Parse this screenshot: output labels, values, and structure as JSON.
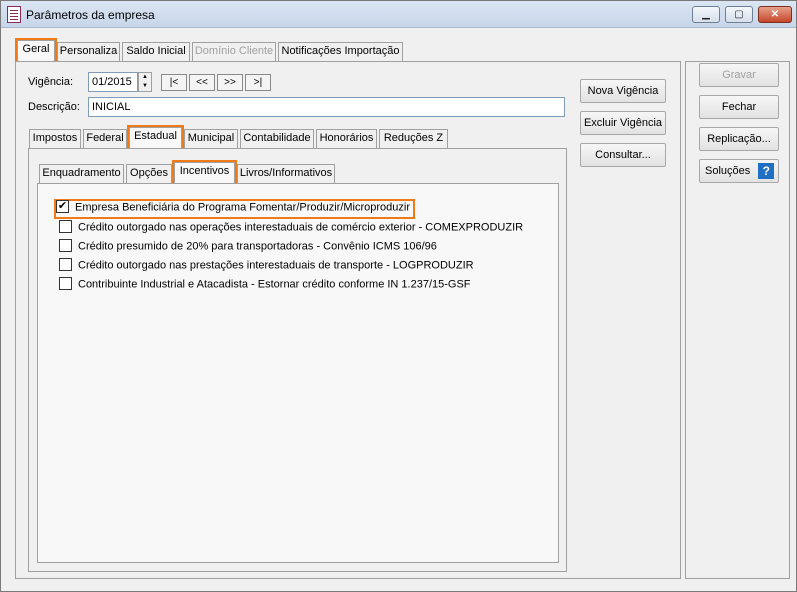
{
  "window": {
    "title": "Parâmetros da empresa"
  },
  "top_tabs": [
    "Geral",
    "Personaliza",
    "Saldo Inicial",
    "Domínio Cliente",
    "Notificações Importação"
  ],
  "vigencia": {
    "label": "Vigência:",
    "value": "01/2015"
  },
  "nav_buttons": [
    "|<",
    "<<",
    ">>",
    ">|"
  ],
  "descricao": {
    "label": "Descrição:",
    "value": "INICIAL"
  },
  "mid_tabs": [
    "Impostos",
    "Federal",
    "Estadual",
    "Municipal",
    "Contabilidade",
    "Honorários",
    "Reduções Z"
  ],
  "inner_tabs": [
    "Enquadramento",
    "Opções",
    "Incentivos",
    "Livros/Informativos"
  ],
  "options": [
    {
      "label": "Empresa Beneficiária do Programa Fomentar/Produzir/Microproduzir",
      "checked": true
    },
    {
      "label": "Crédito outorgado nas operações interestaduais de comércio exterior - COMEXPRODUZIR",
      "checked": false
    },
    {
      "label": "Crédito presumido de 20% para transportadoras - Convênio ICMS 106/96",
      "checked": false
    },
    {
      "label": "Crédito outorgado nas prestações interestaduais de transporte - LOGPRODUZIR",
      "checked": false
    },
    {
      "label": "Contribuinte Industrial e Atacadista - Estornar crédito conforme IN 1.237/15-GSF",
      "checked": false
    }
  ],
  "mid_buttons": {
    "nova_vigencia": "Nova Vigência",
    "excluir_vigencia": "Excluir Vigência",
    "consultar": "Consultar..."
  },
  "right_buttons": {
    "gravar": "Gravar",
    "fechar": "Fechar",
    "replicacao": "Replicação...",
    "solucoes": "Soluções"
  },
  "colors": {
    "highlight": "#f07a18",
    "help_icon": "#1f6fc4"
  }
}
